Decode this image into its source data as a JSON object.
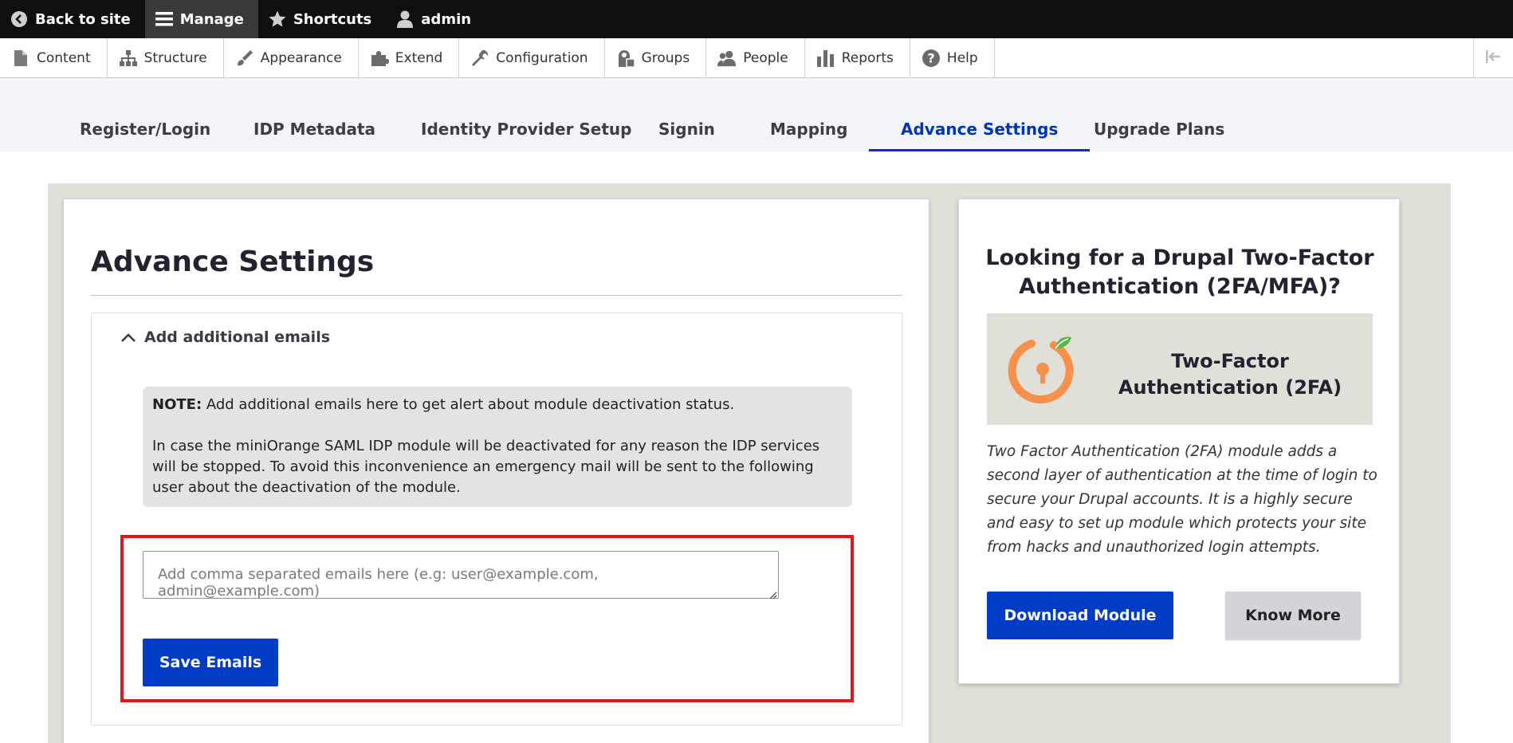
{
  "toolbar": {
    "back_to_site": "Back to site",
    "manage": "Manage",
    "shortcuts": "Shortcuts",
    "user": "admin"
  },
  "tray": {
    "items": [
      {
        "label": "Content",
        "icon": "file-icon"
      },
      {
        "label": "Structure",
        "icon": "sitemap-icon"
      },
      {
        "label": "Appearance",
        "icon": "paintbrush-icon"
      },
      {
        "label": "Extend",
        "icon": "puzzle-icon"
      },
      {
        "label": "Configuration",
        "icon": "wrench-icon"
      },
      {
        "label": "Groups",
        "icon": "groups-icon"
      },
      {
        "label": "People",
        "icon": "people-icon"
      },
      {
        "label": "Reports",
        "icon": "bar-chart-icon"
      },
      {
        "label": "Help",
        "icon": "help-icon"
      }
    ]
  },
  "tabs": [
    {
      "label": "Register/Login",
      "active": false
    },
    {
      "label": "IDP Metadata",
      "active": false
    },
    {
      "label": "Identity Provider Setup",
      "active": false
    },
    {
      "label": "Signin",
      "active": false
    },
    {
      "label": "Mapping",
      "active": false
    },
    {
      "label": "Advance Settings",
      "active": true
    },
    {
      "label": "Upgrade Plans",
      "active": false
    }
  ],
  "main": {
    "title": "Advance Settings",
    "section": {
      "summary": "Add additional emails",
      "note_label": "NOTE:",
      "note_text": " Add additional emails here to get alert about module deactivation status.",
      "note_para2": "In case the miniOrange SAML IDP module will be deactivated for any reason the IDP services will be stopped. To avoid this inconvenience an emergency mail will be sent to the following user about the deactivation of the module.",
      "emails_value": "",
      "emails_placeholder": "Add comma separated emails here (e.g: user@example.com, admin@example.com)",
      "save_label": "Save Emails"
    }
  },
  "promo": {
    "title": "Looking for a Drupal Two-Factor Authentication (2FA/MFA)?",
    "banner_title": "Two-Factor Authentication (2FA)",
    "description": "Two Factor Authentication (2FA) module adds a second layer of authentication at the time of login to secure your Drupal accounts. It is a highly secure and easy to set up module which protects your site from hacks and unauthorized login attempts.",
    "download_label": "Download Module",
    "know_more_label": "Know More"
  },
  "colors": {
    "accent": "#003cc5",
    "active_tab": "#0036b1",
    "highlight": "#e8131b",
    "logo_orange": "#f7904a",
    "logo_green": "#55b94a"
  }
}
